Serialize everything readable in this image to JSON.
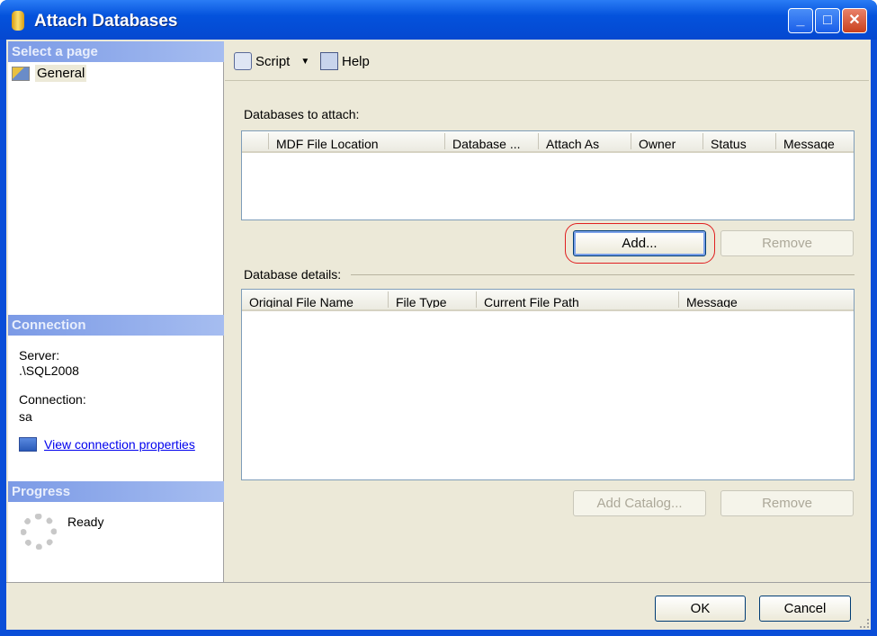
{
  "window": {
    "title": "Attach Databases"
  },
  "left": {
    "select_page_header": "Select a page",
    "pages": [
      {
        "label": "General"
      }
    ],
    "connection_header": "Connection",
    "server_label": "Server:",
    "server_value": ".\\SQL2008",
    "connection_label": "Connection:",
    "connection_value": "sa",
    "view_connection_link": "View connection properties",
    "progress_header": "Progress",
    "progress_status": "Ready"
  },
  "toolbar": {
    "script": "Script",
    "help": "Help"
  },
  "attach": {
    "label": "Databases to attach:",
    "columns": [
      "MDF File Location",
      "Database ...",
      "Attach As",
      "Owner",
      "Status",
      "Message"
    ],
    "add": "Add...",
    "remove": "Remove"
  },
  "details": {
    "label": "Database details:",
    "columns": [
      "Original File Name",
      "File Type",
      "Current File Path",
      "Message"
    ],
    "add_catalog": "Add Catalog...",
    "remove": "Remove"
  },
  "footer": {
    "ok": "OK",
    "cancel": "Cancel"
  }
}
